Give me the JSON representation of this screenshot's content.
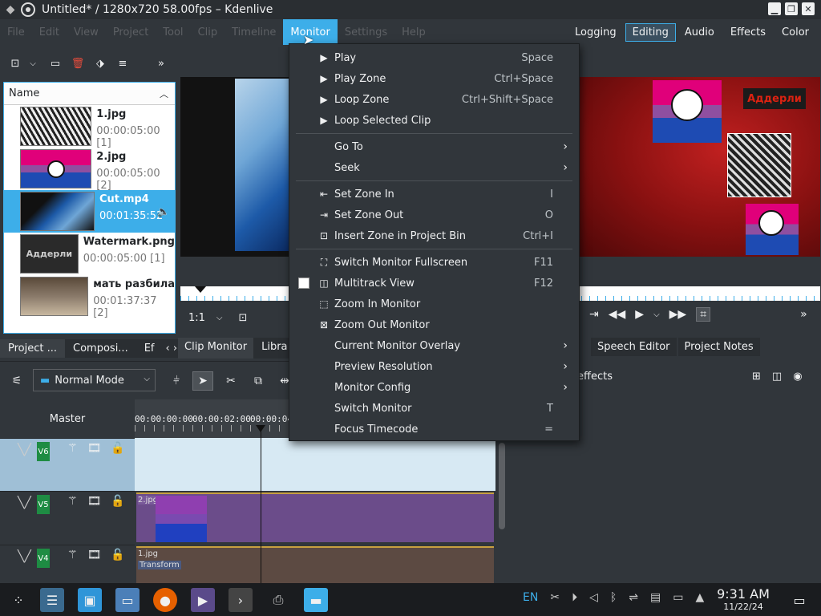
{
  "window": {
    "title": "Untitled* / 1280x720 58.00fps – Kdenlive"
  },
  "menubar": {
    "items": [
      "File",
      "Edit",
      "View",
      "Project",
      "Tool",
      "Clip",
      "Timeline",
      "Monitor",
      "Settings",
      "Help"
    ],
    "active_index": 7
  },
  "layouts": [
    "Logging",
    "Editing",
    "Audio",
    "Effects",
    "Color"
  ],
  "active_layout": "Editing",
  "bin": {
    "column_header": "Name",
    "clips": [
      {
        "name": "1.jpg",
        "duration": "00:00:05:00 [1]"
      },
      {
        "name": "2.jpg",
        "duration": "00:00:05:00 [2]"
      },
      {
        "name": "Cut.mp4",
        "duration": "00:01:35:52"
      },
      {
        "name": "Watermark.png",
        "duration": "00:00:05:00 [1]"
      },
      {
        "name": "мать разбила",
        "duration": "00:01:37:37 [2]"
      }
    ],
    "selected_index": 2,
    "tabs": [
      "Project ...",
      "Composi...",
      "Ef"
    ]
  },
  "monitor": {
    "zoom": "1:1",
    "watermark_text": "Аддерли",
    "tabs": [
      "Clip Monitor",
      "Libra"
    ],
    "right_tabs": [
      "Speech Editor",
      "Project Notes"
    ]
  },
  "context_menu": {
    "items": [
      {
        "label": "Play",
        "shortcut": "Space",
        "icon": "play-icon"
      },
      {
        "label": "Play Zone",
        "shortcut": "Ctrl+Space",
        "icon": "play-icon"
      },
      {
        "label": "Loop Zone",
        "shortcut": "Ctrl+Shift+Space",
        "icon": "play-icon"
      },
      {
        "label": "Loop Selected Clip",
        "shortcut": "",
        "icon": "play-icon"
      },
      {
        "label": "Go To",
        "shortcut": "",
        "submenu": true
      },
      {
        "label": "Seek",
        "shortcut": "",
        "submenu": true
      },
      {
        "label": "Set Zone In",
        "shortcut": "I",
        "icon": "zone-in-icon"
      },
      {
        "label": "Set Zone Out",
        "shortcut": "O",
        "icon": "zone-out-icon"
      },
      {
        "label": "Insert Zone in Project Bin",
        "shortcut": "Ctrl+I",
        "icon": "insert-zone-icon"
      },
      {
        "label": "Switch Monitor Fullscreen",
        "shortcut": "F11",
        "icon": "fullscreen-icon"
      },
      {
        "label": "Multitrack View",
        "shortcut": "F12",
        "icon": "multitrack-icon",
        "checkbox": true
      },
      {
        "label": "Zoom In Monitor",
        "shortcut": "",
        "icon": "zoom-in-icon"
      },
      {
        "label": "Zoom Out Monitor",
        "shortcut": "",
        "icon": "zoom-out-icon"
      },
      {
        "label": "Current Monitor Overlay",
        "shortcut": "",
        "submenu": true
      },
      {
        "label": "Preview Resolution",
        "shortcut": "",
        "submenu": true
      },
      {
        "label": "Monitor Config",
        "shortcut": "",
        "submenu": true
      },
      {
        "label": "Switch Monitor",
        "shortcut": "T"
      },
      {
        "label": "Focus Timecode",
        "shortcut": "="
      }
    ]
  },
  "timeline": {
    "mode": "Normal Mode",
    "master_label": "Master",
    "ruler": [
      "00:00:00:00",
      "00:00:02:00",
      "00:00:04:0"
    ],
    "tracks": [
      {
        "name": "V6"
      },
      {
        "name": "V5",
        "clip_label": "2.jpg"
      },
      {
        "name": "V4",
        "clip_label": "1.jpg",
        "clip_sublabel": "Transform"
      }
    ]
  },
  "effects_panel": {
    "label": "effects"
  },
  "taskbar": {
    "time": "9:31 AM",
    "date": "11/22/24",
    "lang": "EN"
  },
  "colors": {
    "accent": "#3daee9",
    "window": "#31363b",
    "track_green": "#1e8c43"
  }
}
